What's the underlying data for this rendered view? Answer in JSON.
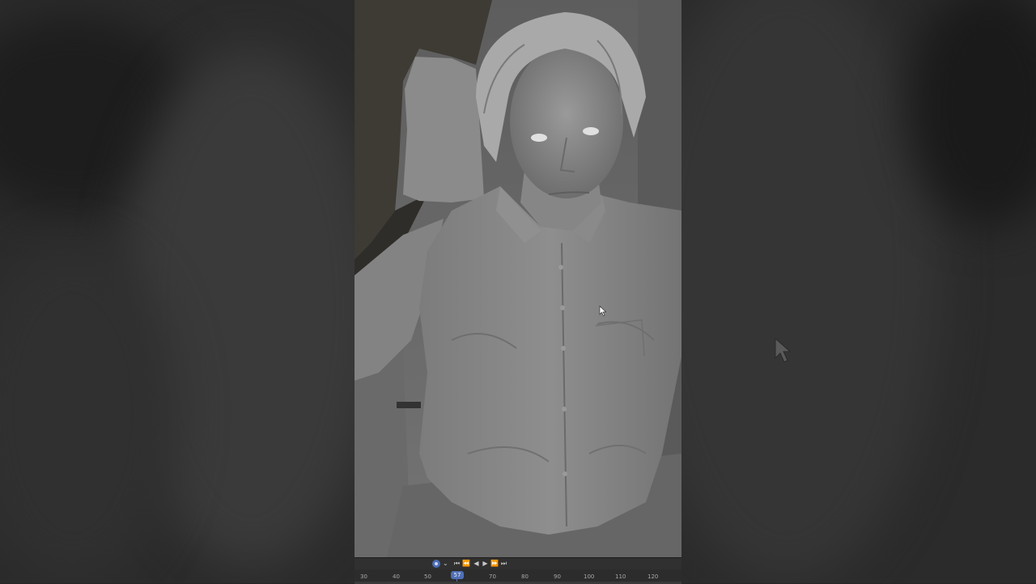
{
  "viewport": {
    "subject": "sculpted-figure"
  },
  "timeline": {
    "controls": [
      "record",
      "jump-start",
      "prev-keyframe",
      "play-reverse",
      "play",
      "next-keyframe",
      "jump-end"
    ],
    "ticks": [
      "30",
      "40",
      "50",
      "57",
      "70",
      "80",
      "90",
      "100",
      "110",
      "120"
    ],
    "current_frame": "57"
  },
  "colors": {
    "accent": "#4f6fb5",
    "panel": "#2c2c2c"
  }
}
